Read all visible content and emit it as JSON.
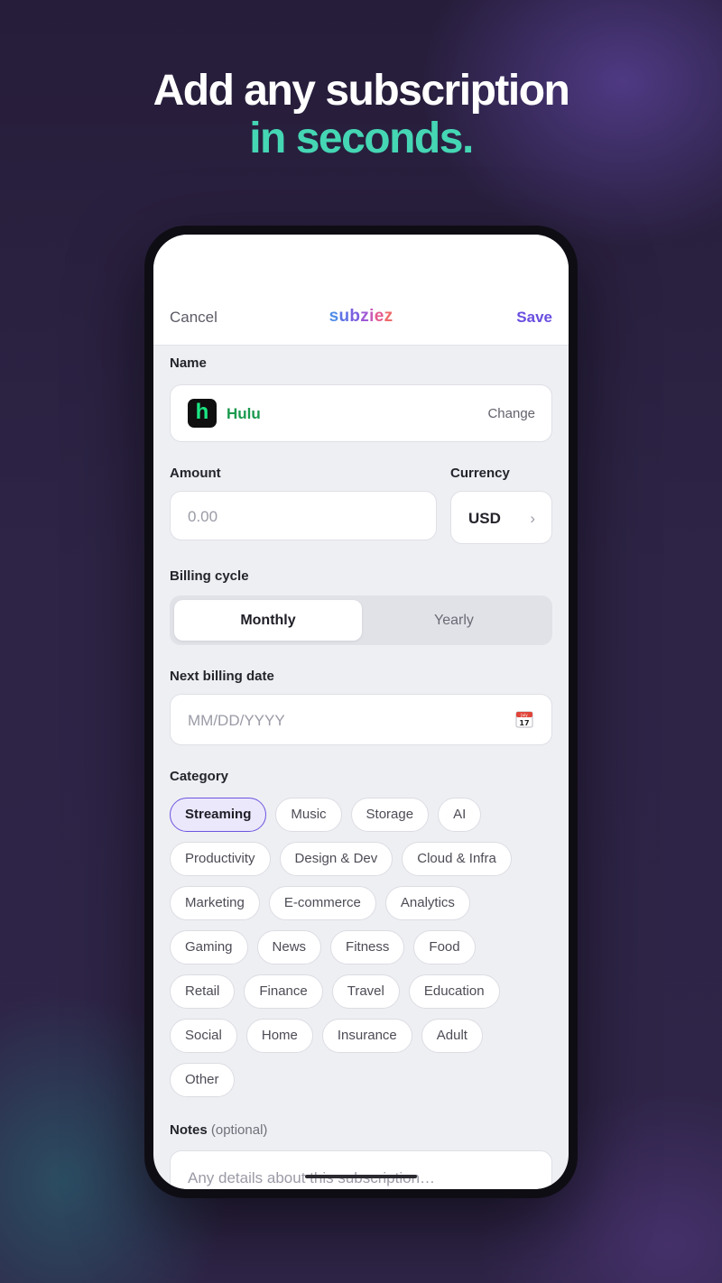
{
  "headline": {
    "line1": "Add any subscription",
    "line2": "in seconds."
  },
  "topbar": {
    "cancel_label": "Cancel",
    "brand_letters": [
      "s",
      "u",
      "b",
      "z",
      "i",
      "e",
      "z"
    ],
    "save_label": "Save"
  },
  "form": {
    "name": {
      "label": "Name",
      "service_name": "Hulu",
      "logo_letter": "h",
      "change_label": "Change"
    },
    "amount": {
      "label": "Amount",
      "placeholder": "0.00"
    },
    "currency": {
      "label": "Currency",
      "value": "USD",
      "chevron": "›"
    },
    "billing_cycle": {
      "label": "Billing cycle",
      "options": [
        "Monthly",
        "Yearly"
      ],
      "selected": "Monthly"
    },
    "next_billing_date": {
      "label": "Next billing date",
      "placeholder": "MM/DD/YYYY",
      "icon": "calendar-icon",
      "icon_month": "July",
      "icon_day": "17"
    },
    "category": {
      "label": "Category",
      "selected": "Streaming",
      "rows": [
        [
          "Streaming",
          "Music",
          "Storage",
          "AI"
        ],
        [
          "Productivity",
          "Design & Dev",
          "Cloud & Infra"
        ],
        [
          "Marketing",
          "E-commerce",
          "Analytics"
        ],
        [
          "Gaming",
          "News",
          "Fitness",
          "Food"
        ],
        [
          "Retail",
          "Finance",
          "Travel",
          "Education"
        ],
        [
          "Social",
          "Home",
          "Insurance",
          "Adult"
        ],
        [
          "Other"
        ]
      ]
    },
    "notes": {
      "label": "Notes",
      "optional_label": "(optional)",
      "placeholder": "Any details about this subscription…"
    }
  },
  "colors": {
    "accent": "#6a4fe0",
    "headline_accent": "#45d6b4",
    "hulu_green": "#1ce783"
  }
}
